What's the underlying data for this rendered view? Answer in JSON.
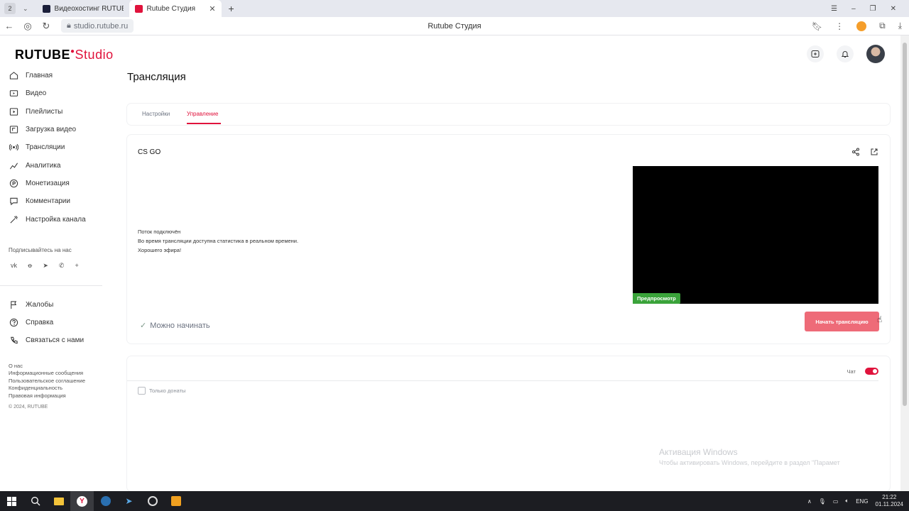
{
  "browser": {
    "tab_count": "2",
    "tabs": [
      {
        "title": "Видеохостинг RUTUBE. С"
      },
      {
        "title": "Rutube Студия"
      }
    ],
    "url": "studio.rutube.ru",
    "page_title": "Rutube Студия"
  },
  "logo": {
    "brand": "RUTUBE",
    "studio": "Studio"
  },
  "sidebar": {
    "items": [
      {
        "label": "Главная",
        "icon": "home-icon"
      },
      {
        "label": "Видео",
        "icon": "video-icon"
      },
      {
        "label": "Плейлисты",
        "icon": "playlist-icon"
      },
      {
        "label": "Загрузка видео",
        "icon": "upload-icon"
      },
      {
        "label": "Трансляции",
        "icon": "broadcast-icon"
      },
      {
        "label": "Аналитика",
        "icon": "analytics-icon"
      },
      {
        "label": "Монетизация",
        "icon": "monetization-icon"
      },
      {
        "label": "Комментарии",
        "icon": "comments-icon"
      },
      {
        "label": "Настройка канала",
        "icon": "settings-icon"
      }
    ],
    "subscribe_label": "Подписывайтесь на нас",
    "social": [
      "vk",
      "ok",
      "telegram",
      "viber",
      "more"
    ],
    "bottom_items": [
      {
        "label": "Жалобы",
        "icon": "flag-icon"
      },
      {
        "label": "Справка",
        "icon": "help-icon"
      },
      {
        "label": "Связаться с нами",
        "icon": "contact-icon"
      }
    ],
    "footer_links": [
      "О нас",
      "Информационные сообщения",
      "Пользовательское соглашение",
      "Конфиденциальность",
      "Правовая информация"
    ],
    "copyright": "© 2024, RUTUBE"
  },
  "main": {
    "title": "Трансляция",
    "tabs": [
      {
        "label": "Настройки",
        "active": false
      },
      {
        "label": "Управление",
        "active": true
      }
    ],
    "stream": {
      "name": "CS GO",
      "status_lines": [
        "Поток подключён",
        "Во время трансляции доступна статистика в реальном времени.",
        "Хорошего эфира!"
      ],
      "preview_badge": "Предпросмотр",
      "ready_text": "Можно начинать",
      "start_button": "Начать трансляцию"
    },
    "chat": {
      "label": "Чат",
      "enabled": true,
      "donations_only": "Только донаты"
    }
  },
  "watermark": {
    "line1": "Активация Windows",
    "line2": "Чтобы активировать Windows, перейдите в раздел \"Парамет"
  },
  "taskbar": {
    "lang": "ENG",
    "time": "21:22",
    "date": "01.11.2024"
  },
  "colors": {
    "accent": "#e0133c",
    "start_button": "#ee6b78",
    "preview_badge": "#3aa33a",
    "support_fab": "#1aa6a6"
  }
}
